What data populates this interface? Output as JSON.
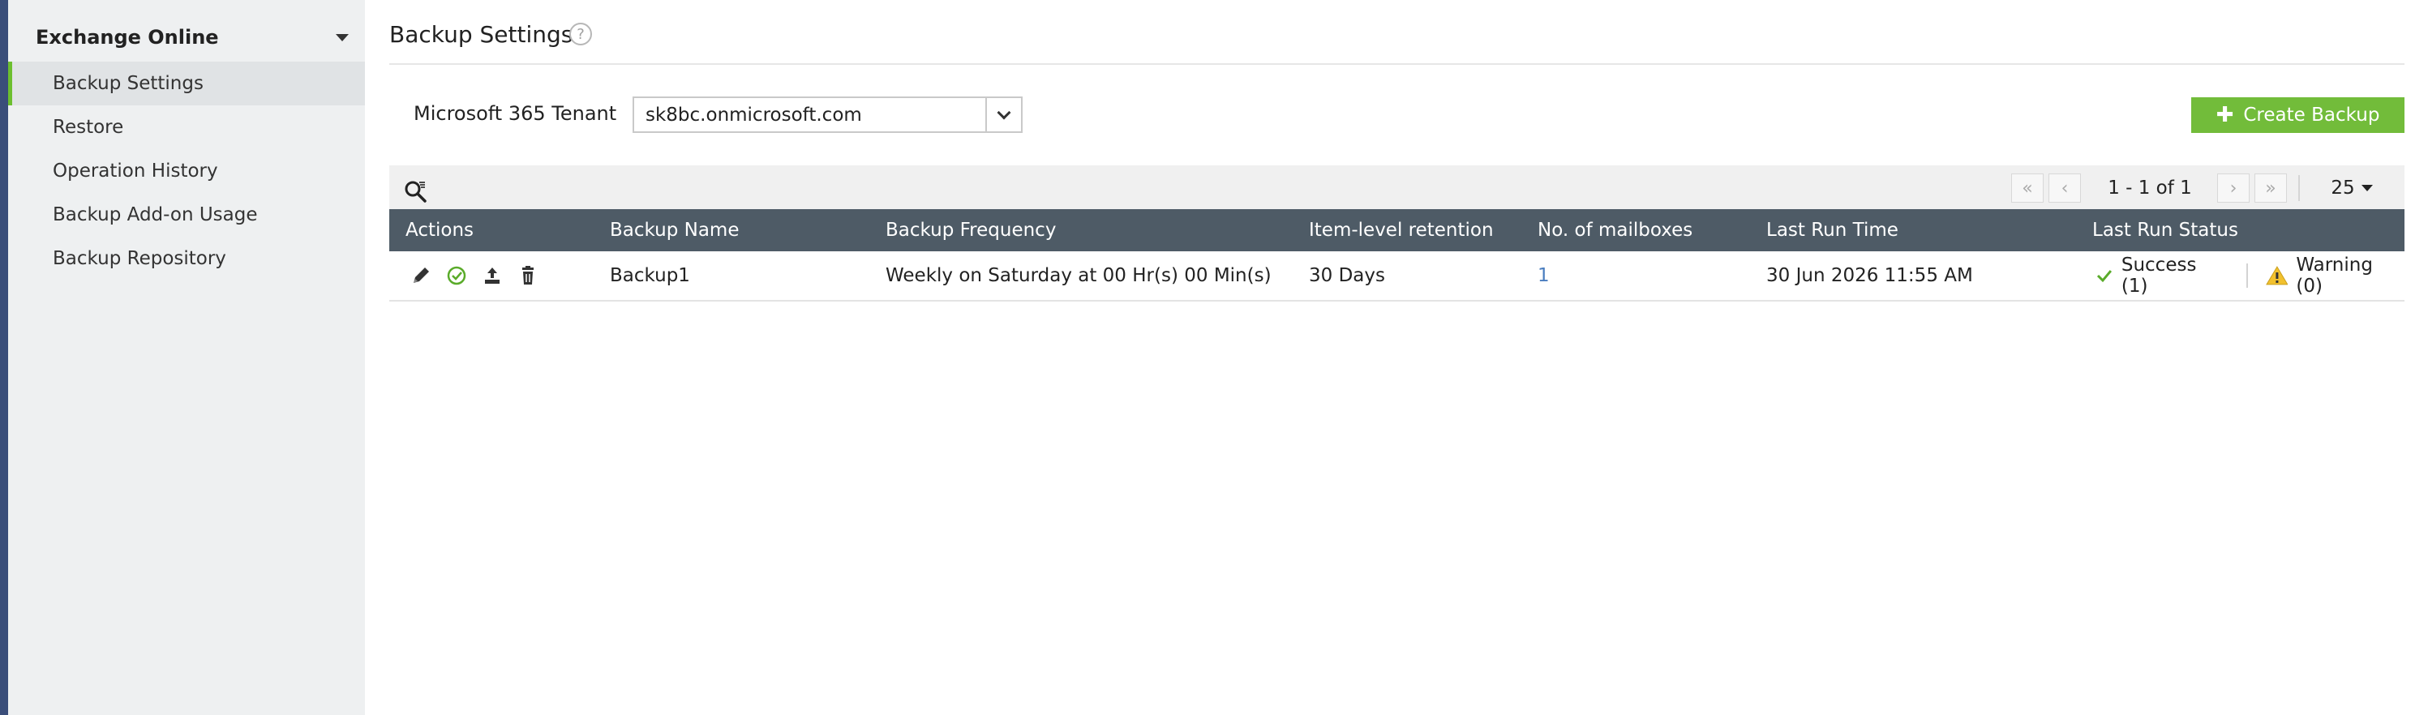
{
  "sidebar": {
    "section_title": "Exchange Online",
    "items": [
      {
        "label": "Backup Settings",
        "active": true
      },
      {
        "label": "Restore",
        "active": false
      },
      {
        "label": "Operation History",
        "active": false
      },
      {
        "label": "Backup Add-on Usage",
        "active": false
      },
      {
        "label": "Backup Repository",
        "active": false
      }
    ]
  },
  "header": {
    "title": "Backup Settings",
    "help_icon": "help-circle-icon"
  },
  "tenant": {
    "label": "Microsoft 365 Tenant",
    "value": "sk8bc.onmicrosoft.com"
  },
  "actions": {
    "create_label": "Create Backup",
    "create_color": "#72bc3a"
  },
  "pager": {
    "range_text": "1 - 1 of 1",
    "per_page": "25"
  },
  "table": {
    "columns": [
      "Actions",
      "Backup Name",
      "Backup Frequency",
      "Item-level retention",
      "No. of mailboxes",
      "Last Run Time",
      "Last Run Status"
    ],
    "rows": [
      {
        "name": "Backup1",
        "frequency": "Weekly on Saturday at 00 Hr(s) 00 Min(s)",
        "retention": "30 Days",
        "mailboxes": "1",
        "last_run_time": "30 Jun 2026 11:55 AM",
        "status_success": "Success (1)",
        "status_warning": "Warning (0)"
      }
    ]
  },
  "colors": {
    "accent_green": "#72bc3a",
    "header_bg": "#4e5b66",
    "warning_yellow": "#f2c12e",
    "success_check": "#5aab2a"
  }
}
